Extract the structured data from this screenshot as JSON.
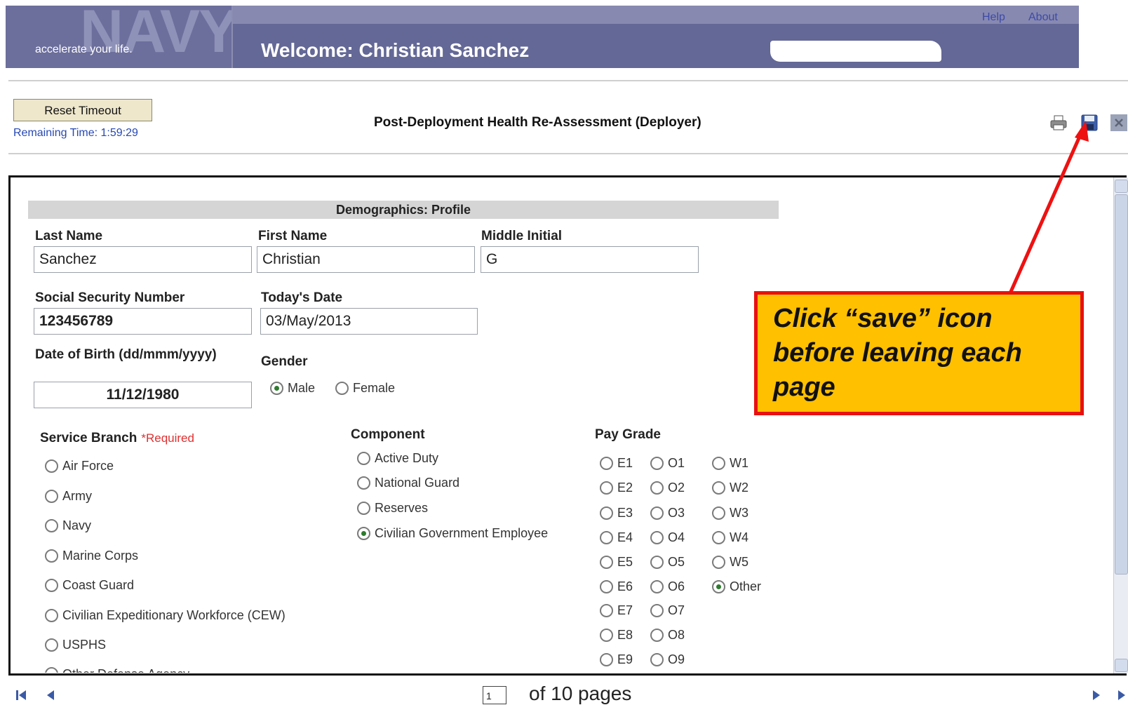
{
  "header": {
    "logo_word": "NAVY",
    "logo_tagline": "accelerate your life.",
    "welcome": "Welcome: Christian Sanchez",
    "help_label": "Help",
    "about_label": "About"
  },
  "toolbar": {
    "reset_label": "Reset Timeout",
    "remaining": "Remaining Time: 1:59:29",
    "title": "Post-Deployment Health Re-Assessment (Deployer)",
    "icons": [
      "print-icon",
      "save-icon",
      "close-icon"
    ]
  },
  "form": {
    "section_title": "Demographics: Profile",
    "last_name": {
      "label": "Last Name",
      "value": "Sanchez"
    },
    "first_name": {
      "label": "First Name",
      "value": "Christian"
    },
    "middle_initial": {
      "label": "Middle Initial",
      "value": "G"
    },
    "ssn": {
      "label": "Social Security Number",
      "value": "123456789"
    },
    "todays_date": {
      "label": "Today's Date",
      "value": "03/May/2013"
    },
    "dob": {
      "label": "Date of Birth (dd/mmm/yyyy)",
      "value": "11/12/1980"
    },
    "gender": {
      "label": "Gender",
      "options": [
        "Male",
        "Female"
      ],
      "selected": "Male"
    },
    "service_branch": {
      "label": "Service Branch",
      "required": "*Required",
      "options": [
        "Air Force",
        "Army",
        "Navy",
        "Marine Corps",
        "Coast Guard",
        "Civilian Expeditionary Workforce (CEW)",
        "USPHS",
        "Other Defense Agency"
      ]
    },
    "component": {
      "label": "Component",
      "options": [
        "Active Duty",
        "National Guard",
        "Reserves",
        "Civilian Government Employee"
      ],
      "selected": "Civilian Government Employee"
    },
    "pay_grade": {
      "label": "Pay Grade",
      "e": [
        "E1",
        "E2",
        "E3",
        "E4",
        "E5",
        "E6",
        "E7",
        "E8",
        "E9"
      ],
      "o": [
        "O1",
        "O2",
        "O3",
        "O4",
        "O5",
        "O6",
        "O7",
        "O8",
        "O9"
      ],
      "w": [
        "W1",
        "W2",
        "W3",
        "W4",
        "W5",
        "Other"
      ],
      "selected": "Other"
    }
  },
  "callout": {
    "text": "Click  “save” icon before leaving each page"
  },
  "pager": {
    "current_page": "1",
    "of_text": "of 10 pages"
  },
  "colors": {
    "header_bg": "#646896",
    "callout_bg": "#ffc000",
    "callout_border": "#e81010",
    "arrow": "#ee1111"
  }
}
